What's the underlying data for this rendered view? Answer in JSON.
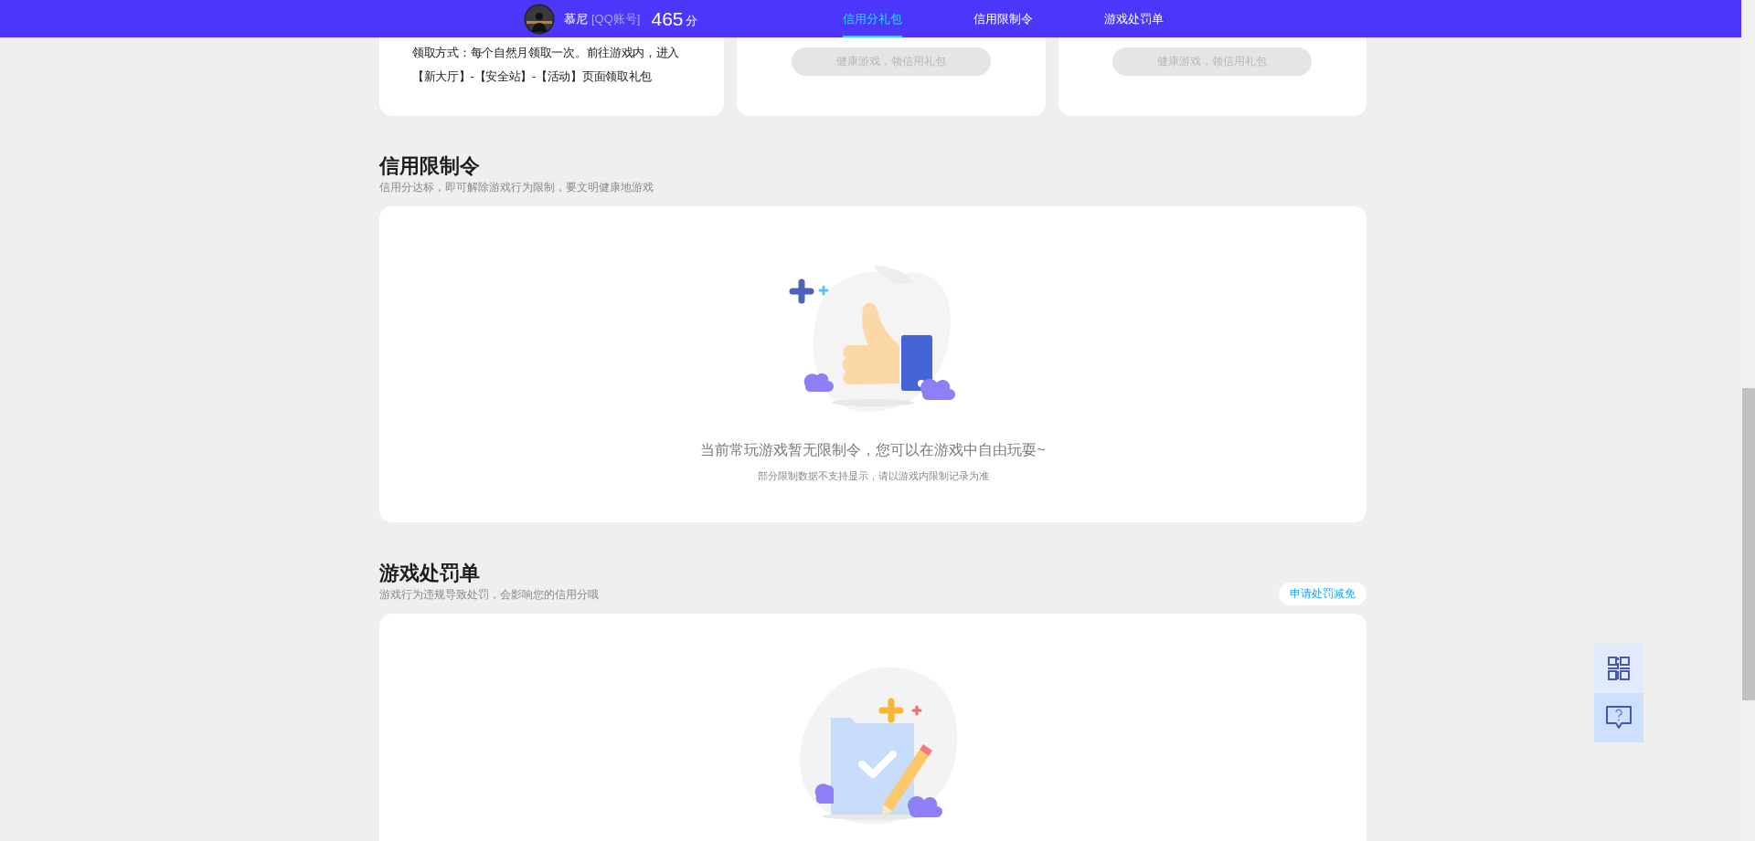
{
  "header": {
    "user": {
      "name": "慕尼",
      "account_type": "[QQ账号]",
      "score": "465",
      "score_unit": "分"
    },
    "nav": [
      {
        "label": "信用分礼包",
        "selected": true
      },
      {
        "label": "信用限制令",
        "selected": false
      },
      {
        "label": "游戏处罚单",
        "selected": false
      }
    ]
  },
  "gift_cards": [
    {
      "kind": "text",
      "text": "领取方式：每个自然月领取一次。前往游戏内，进入【新大厅】-【安全站】-【活动】页面领取礼包"
    },
    {
      "kind": "button",
      "button": {
        "label": "健康游戏，领信用礼包",
        "disabled": true
      }
    },
    {
      "kind": "button",
      "button": {
        "label": "健康游戏，领信用礼包",
        "disabled": true
      }
    }
  ],
  "sections": [
    {
      "kind": "restrictions",
      "title": "信用限制令",
      "subtitle": "信用分达标，即可解除游戏行为限制，要文明健康地游戏",
      "empty_state": {
        "message": "当前常玩游戏暂无限制令，您可以在游戏中自由玩耍~",
        "note": "部分限制数据不支持显示，请以游戏内限制记录为准"
      }
    },
    {
      "kind": "penalties",
      "title": "游戏处罚单",
      "subtitle": "游戏行为违规导致处罚，会影响您的信用分哦",
      "action": {
        "label": "申请处罚减免"
      }
    }
  ]
}
